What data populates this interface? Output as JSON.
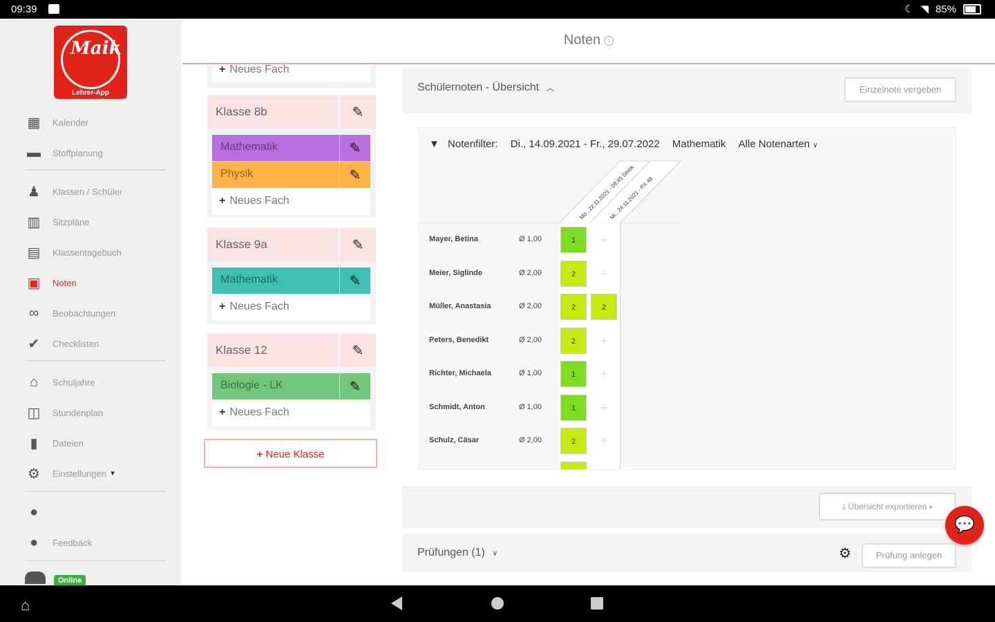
{
  "statusbar": {
    "time": "09:39",
    "battery": "85%"
  },
  "app": {
    "logo_text": "Maik",
    "logo_sub": "Lehrer-App",
    "title": "Noten",
    "accent": "#e2231a"
  },
  "sidebar": {
    "items": [
      {
        "label": "Kalender",
        "icon": "calendar-icon"
      },
      {
        "label": "Stoffplanung",
        "icon": "archive-icon"
      },
      {
        "label": "Klassen / Schüler",
        "icon": "users-icon"
      },
      {
        "label": "Sitzpläne",
        "icon": "grid-icon"
      },
      {
        "label": "Klassentagebuch",
        "icon": "book-icon"
      },
      {
        "label": "Noten",
        "icon": "grade-icon"
      },
      {
        "label": "Beobachtungen",
        "icon": "binoculars-icon"
      },
      {
        "label": "Checklisten",
        "icon": "check-circle-icon"
      },
      {
        "label": "Schuljahre",
        "icon": "graduation-cap-icon"
      },
      {
        "label": "Stundenplan",
        "icon": "timetable-icon"
      },
      {
        "label": "Dateien",
        "icon": "file-icon"
      },
      {
        "label": "Einstellungen",
        "icon": "gear-icon"
      },
      {
        "label": "",
        "icon": "user-icon"
      },
      {
        "label": "Feedback",
        "icon": "comment-icon"
      }
    ],
    "online_badge": "Online"
  },
  "classes": {
    "top_new_subject": "Neues Fach",
    "list": [
      {
        "name": "Klasse 8b",
        "subjects": [
          {
            "name": "Mathematik",
            "color": "#b86ee0"
          },
          {
            "name": "Physik",
            "color": "#ffb347"
          }
        ],
        "new_subject": "Neues Fach"
      },
      {
        "name": "Klasse 9a",
        "subjects": [
          {
            "name": "Mathematik",
            "color": "#3fbfb0"
          }
        ],
        "new_subject": "Neues Fach"
      },
      {
        "name": "Klasse 12",
        "subjects": [
          {
            "name": "Biologie - LK",
            "color": "#72c57a"
          }
        ],
        "new_subject": "Neues Fach"
      }
    ],
    "new_class": "Neue Klasse"
  },
  "overview": {
    "title": "Schülernoten - Übersicht",
    "single_grade_button": "Einzelnote vergeben",
    "filter_label": "Notenfilter:",
    "filter_range": "Di., 14.09.2021 - Fr., 29.07.2022",
    "filter_subject": "Mathematik",
    "filter_types": "Alle Notenarten",
    "columns": [
      "Mo., 22.11.2021 - 08:45 Streik",
      "Mi., 24.11.2021 - PX 48"
    ],
    "students": [
      {
        "name": "Mayer, Betina",
        "avg": "Ø 1,00",
        "grades": [
          "1",
          ""
        ]
      },
      {
        "name": "Meier, Siglinde",
        "avg": "Ø 2,00",
        "grades": [
          "2",
          ""
        ]
      },
      {
        "name": "Müller, Anastasia",
        "avg": "Ø 2,00",
        "grades": [
          "2",
          "2"
        ]
      },
      {
        "name": "Peters, Benedikt",
        "avg": "Ø 2,00",
        "grades": [
          "2",
          ""
        ]
      },
      {
        "name": "Richter, Michaela",
        "avg": "Ø 1,00",
        "grades": [
          "1",
          ""
        ]
      },
      {
        "name": "Schmidt, Anton",
        "avg": "Ø 1,00",
        "grades": [
          "1",
          ""
        ]
      },
      {
        "name": "Schulz, Cäsar",
        "avg": "Ø 2,00",
        "grades": [
          "2",
          ""
        ]
      }
    ],
    "grade_colors": {
      "1": "#7ddc1f",
      "2": "#c5ea12"
    },
    "export_button": "Übersicht exportieren"
  },
  "exams": {
    "title": "Prüfungen (1)",
    "create_button": "Prüfung anlegen"
  }
}
